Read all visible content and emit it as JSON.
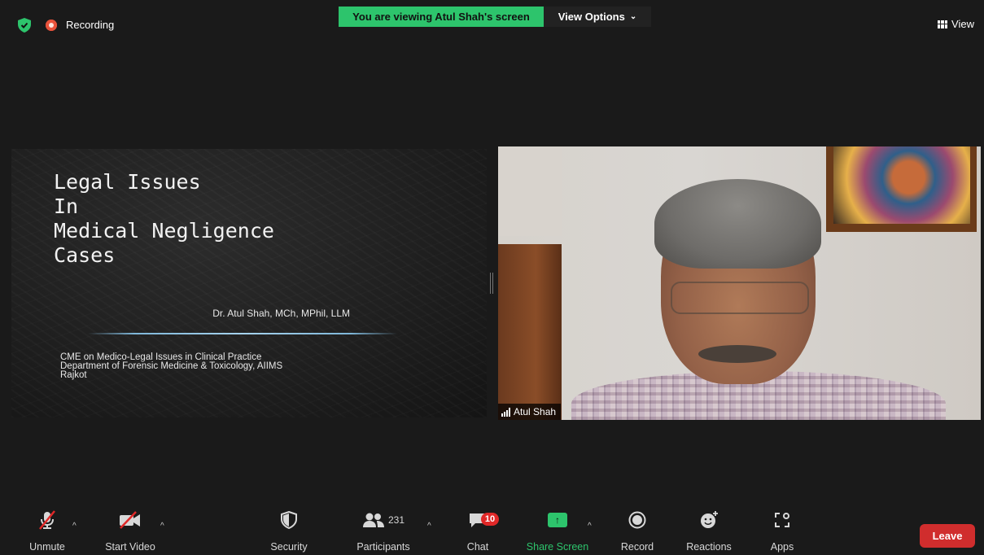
{
  "top_bar": {
    "recording_label": "Recording",
    "viewing_banner": "You are viewing Atul Shah's screen",
    "view_options_label": "View Options",
    "view_label": "View"
  },
  "slide": {
    "title_lines": [
      "Legal Issues",
      "In",
      "Medical Negligence",
      "Cases"
    ],
    "author": "Dr. Atul Shah, MCh, MPhil, LLM",
    "footer_lines": [
      "CME on Medico-Legal Issues in Clinical Practice",
      "Department of Forensic Medicine & Toxicology, AIIMS",
      "Rajkot"
    ]
  },
  "video": {
    "participant_name": "Atul Shah"
  },
  "toolbar": {
    "unmute_label": "Unmute",
    "start_video_label": "Start Video",
    "security_label": "Security",
    "participants_label": "Participants",
    "participants_count": "231",
    "chat_label": "Chat",
    "chat_badge": "10",
    "share_screen_label": "Share Screen",
    "record_label": "Record",
    "reactions_label": "Reactions",
    "apps_label": "Apps",
    "leave_label": "Leave"
  },
  "colors": {
    "banner_green": "#2dc46c",
    "leave_red": "#d02d2d",
    "badge_red": "#e02828",
    "recording_dot": "#e8523b"
  }
}
